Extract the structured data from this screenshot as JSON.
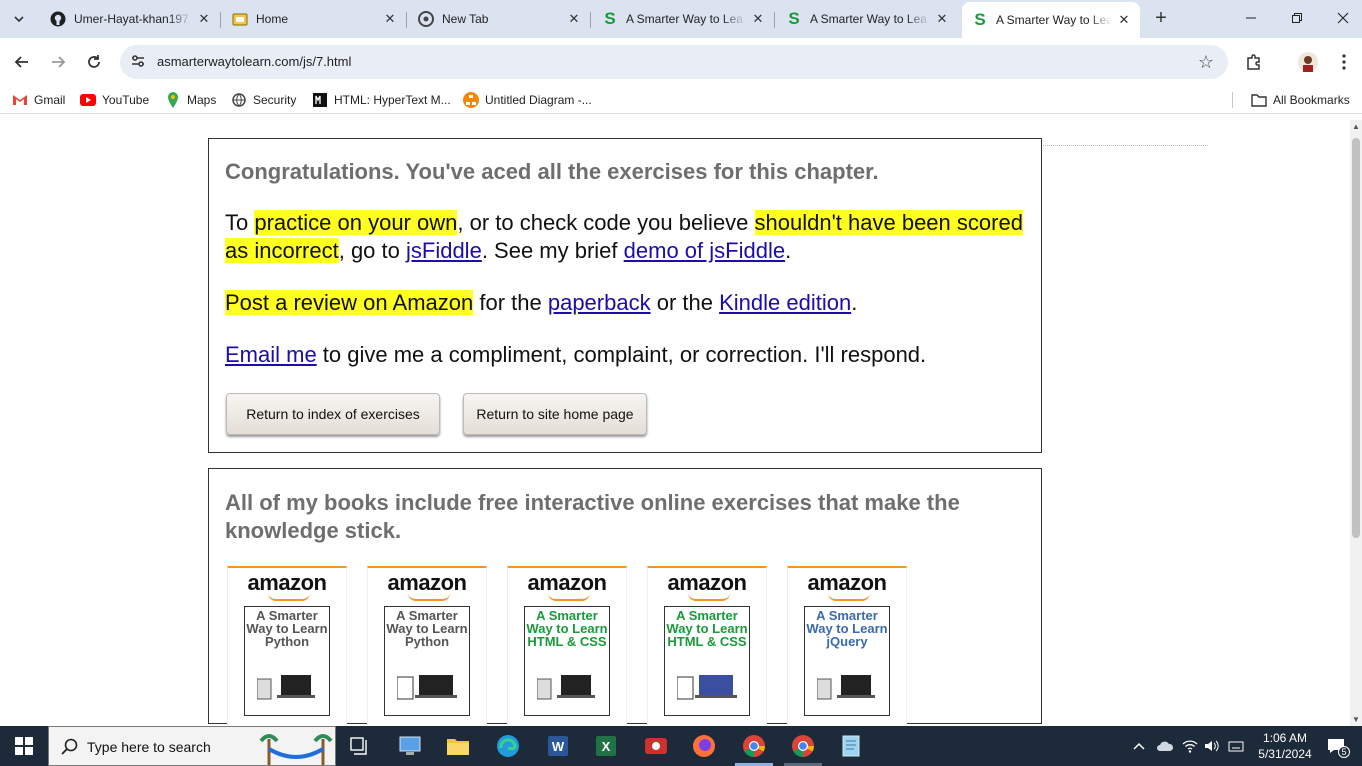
{
  "browser": {
    "tabs": [
      {
        "title": "Umer-Hayat-khan197",
        "icon": "github-icon"
      },
      {
        "title": "Home",
        "icon": "home-folder-icon"
      },
      {
        "title": "New Tab",
        "icon": "chrome-icon"
      },
      {
        "title": "A Smarter Way to Lea",
        "icon": "s-logo-icon"
      },
      {
        "title": "A Smarter Way to Lea",
        "icon": "s-logo-icon"
      },
      {
        "title": "A Smarter Way to Lea",
        "icon": "s-logo-icon"
      }
    ],
    "url": "asmarterwaytolearn.com/js/7.html",
    "bookmarks": [
      "Gmail",
      "YouTube",
      "Maps",
      "Security",
      "HTML: HyperText M...",
      "Untitled Diagram -..."
    ],
    "all_bookmarks": "All Bookmarks"
  },
  "page": {
    "congrats": "Congratulations. You've aced all the exercises for this chapter.",
    "p1": {
      "t1": "To ",
      "h1": "practice on your own",
      "t2": ", or to check code you believe ",
      "h2": "shouldn't have been scored as incorrect",
      "t3": ", go to ",
      "l1": "jsFiddle",
      "t4": ". See my brief ",
      "l2": "demo of jsFiddle",
      "t5": "."
    },
    "p2": {
      "h1": "Post a review on Amazon",
      "t1": " for the ",
      "l1": "paperback",
      "t2": " or the ",
      "l2": "Kindle edition",
      "t3": "."
    },
    "p3": {
      "l1": "Email me",
      "t1": " to give me a compliment, complaint, or correction. I'll respond."
    },
    "buttons": {
      "index": "Return to index of exercises",
      "home": "Return to site home page"
    },
    "books_title": "All of my books include free interactive online exercises that make the knowledge stick.",
    "books": [
      {
        "logo": "amazon",
        "cover": "A Smarter Way to Learn Python",
        "color": "#555555"
      },
      {
        "logo": "amazon",
        "cover": "A Smarter Way to Learn Python",
        "color": "#555555"
      },
      {
        "logo": "amazon",
        "cover": "A Smarter Way to Learn HTML & CSS",
        "color": "#1a9a3a"
      },
      {
        "logo": "amazon",
        "cover": "A Smarter Way to Learn HTML & CSS",
        "color": "#1a9a3a"
      },
      {
        "logo": "amazon",
        "cover": "A Smarter Way to Learn jQuery",
        "color": "#3a6ab0"
      }
    ]
  },
  "taskbar": {
    "search_placeholder": "Type here to search",
    "time": "1:06 AM",
    "date": "5/31/2024",
    "notification_count": "5"
  }
}
